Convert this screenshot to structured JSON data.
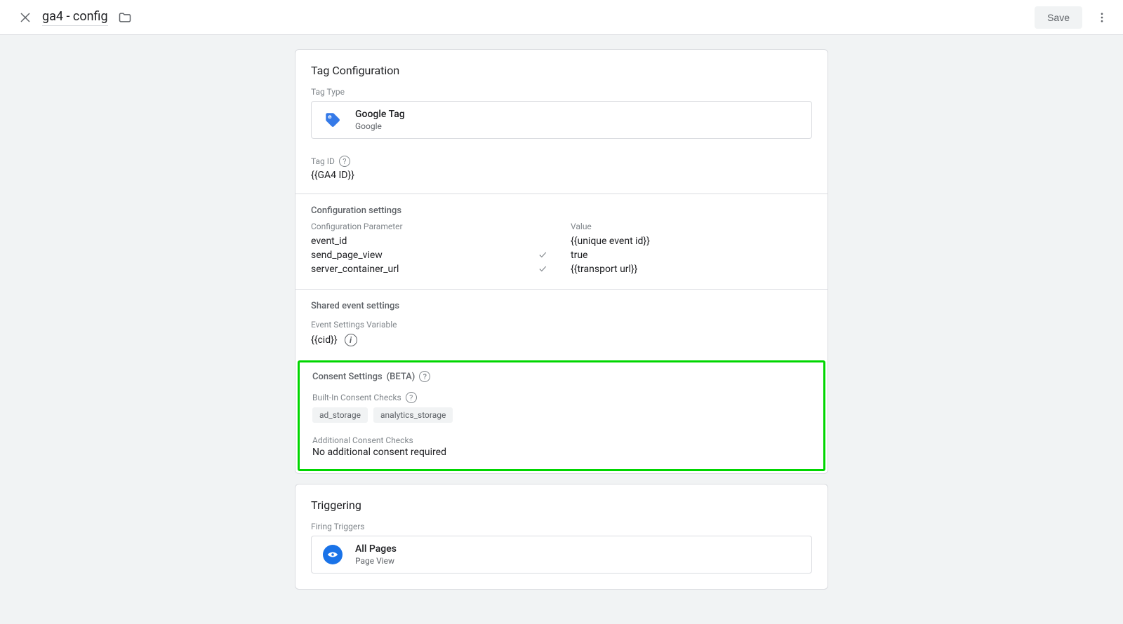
{
  "header": {
    "title": "ga4 - config",
    "save_label": "Save"
  },
  "tag_config": {
    "card_title": "Tag Configuration",
    "tag_type_label": "Tag Type",
    "tag_type": {
      "title": "Google Tag",
      "subtitle": "Google"
    },
    "tag_id": {
      "label": "Tag ID",
      "value": "{{GA4 ID}}"
    },
    "config_settings": {
      "heading": "Configuration settings",
      "headers": {
        "param": "Configuration Parameter",
        "value": "Value"
      },
      "rows": [
        {
          "param": "event_id",
          "check": false,
          "value": "{{unique event id}}"
        },
        {
          "param": "send_page_view",
          "check": true,
          "value": "true"
        },
        {
          "param": "server_container_url",
          "check": true,
          "value": "{{transport url}}"
        }
      ]
    },
    "shared_event": {
      "heading": "Shared event settings",
      "label": "Event Settings Variable",
      "value": "{{cid}}"
    },
    "consent": {
      "heading": "Consent Settings",
      "beta": "(BETA)",
      "builtin_label": "Built-In Consent Checks",
      "chips": [
        "ad_storage",
        "analytics_storage"
      ],
      "additional_label": "Additional Consent Checks",
      "additional_text": "No additional consent required"
    }
  },
  "triggering": {
    "card_title": "Triggering",
    "firing_label": "Firing Triggers",
    "trigger": {
      "title": "All Pages",
      "subtitle": "Page View"
    }
  }
}
